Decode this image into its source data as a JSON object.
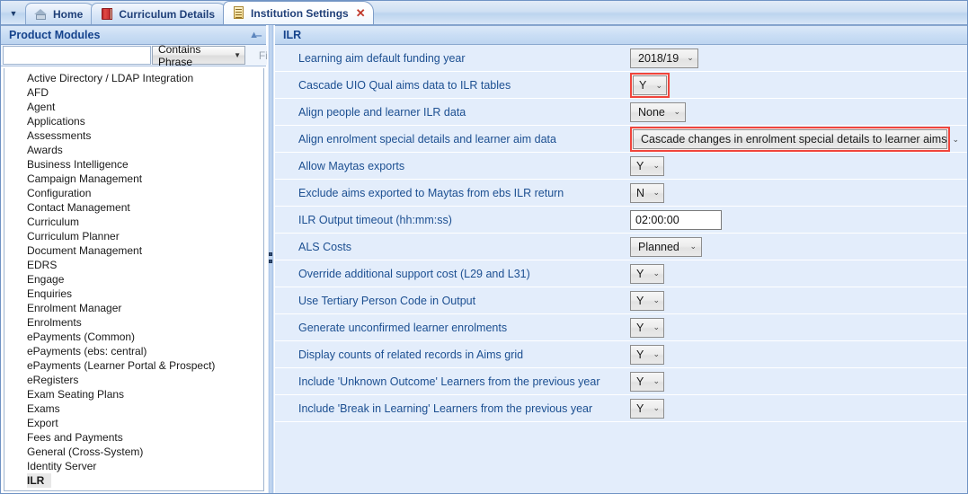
{
  "window": {
    "tab_dropdown_icon": "chevron-down-icon"
  },
  "tabs": [
    {
      "label": "Home",
      "icon": "home-icon",
      "active": false,
      "closable": false
    },
    {
      "label": "Curriculum Details",
      "icon": "book-icon",
      "active": false,
      "closable": false
    },
    {
      "label": "Institution Settings",
      "icon": "document-icon",
      "active": true,
      "closable": true,
      "close_label": "✕"
    }
  ],
  "left_panel": {
    "title": "Product Modules",
    "collapse_icon": "chevron-double-up-icon",
    "search": {
      "value": "",
      "placeholder": "",
      "match_mode": "Contains Phrase",
      "match_mode_arrow": "▼",
      "find_label": "Find"
    },
    "modules": [
      {
        "label": "Active Directory / LDAP Integration",
        "selected": false
      },
      {
        "label": "AFD",
        "selected": false
      },
      {
        "label": "Agent",
        "selected": false
      },
      {
        "label": "Applications",
        "selected": false
      },
      {
        "label": "Assessments",
        "selected": false
      },
      {
        "label": "Awards",
        "selected": false
      },
      {
        "label": "Business Intelligence",
        "selected": false
      },
      {
        "label": "Campaign Management",
        "selected": false
      },
      {
        "label": "Configuration",
        "selected": false
      },
      {
        "label": "Contact Management",
        "selected": false
      },
      {
        "label": "Curriculum",
        "selected": false
      },
      {
        "label": "Curriculum Planner",
        "selected": false
      },
      {
        "label": "Document Management",
        "selected": false
      },
      {
        "label": "EDRS",
        "selected": false
      },
      {
        "label": "Engage",
        "selected": false
      },
      {
        "label": "Enquiries",
        "selected": false
      },
      {
        "label": "Enrolment Manager",
        "selected": false
      },
      {
        "label": "Enrolments",
        "selected": false
      },
      {
        "label": "ePayments (Common)",
        "selected": false
      },
      {
        "label": "ePayments (ebs: central)",
        "selected": false
      },
      {
        "label": "ePayments (Learner Portal & Prospect)",
        "selected": false
      },
      {
        "label": "eRegisters",
        "selected": false
      },
      {
        "label": "Exam Seating Plans",
        "selected": false
      },
      {
        "label": "Exams",
        "selected": false
      },
      {
        "label": "Export",
        "selected": false
      },
      {
        "label": "Fees and Payments",
        "selected": false
      },
      {
        "label": "General (Cross-System)",
        "selected": false
      },
      {
        "label": "Identity Server",
        "selected": false
      },
      {
        "label": "ILR",
        "selected": true
      }
    ]
  },
  "right_panel": {
    "section_title": "ILR",
    "settings": [
      {
        "label": "Learning aim default funding year",
        "control": "combo",
        "value": "2018/19",
        "width": "w-year",
        "highlight": false
      },
      {
        "label": "Cascade UIO Qual aims data to ILR tables",
        "control": "combo",
        "value": "Y",
        "width": "w-yn",
        "highlight": true
      },
      {
        "label": "Align people and learner ILR data",
        "control": "combo",
        "value": "None",
        "width": "w-none",
        "highlight": false
      },
      {
        "label": "Align enrolment special details and learner aim data",
        "control": "combo",
        "value": "Cascade changes in enrolment special details to learner aims",
        "width": "w-wide",
        "highlight": true
      },
      {
        "label": "Allow Maytas exports",
        "control": "combo",
        "value": "Y",
        "width": "w-yn",
        "highlight": false
      },
      {
        "label": "Exclude aims exported to Maytas from ebs ILR return",
        "control": "combo",
        "value": "N",
        "width": "w-yn",
        "highlight": false
      },
      {
        "label": "ILR Output timeout (hh:mm:ss)",
        "control": "text",
        "value": "02:00:00",
        "width": "",
        "highlight": false
      },
      {
        "label": "ALS Costs",
        "control": "combo",
        "value": "Planned",
        "width": "w-als",
        "highlight": false
      },
      {
        "label": "Override additional support cost (L29 and L31)",
        "control": "combo",
        "value": "Y",
        "width": "w-yn",
        "highlight": false
      },
      {
        "label": "Use Tertiary Person Code in Output",
        "control": "combo",
        "value": "Y",
        "width": "w-yn",
        "highlight": false
      },
      {
        "label": "Generate unconfirmed learner enrolments",
        "control": "combo",
        "value": "Y",
        "width": "w-yn",
        "highlight": false
      },
      {
        "label": "Display counts of related records in Aims grid",
        "control": "combo",
        "value": "Y",
        "width": "w-yn",
        "highlight": false
      },
      {
        "label": "Include 'Unknown Outcome' Learners from the previous year",
        "control": "combo",
        "value": "Y",
        "width": "w-yn",
        "highlight": false
      },
      {
        "label": "Include 'Break in Learning' Learners from the previous year",
        "control": "combo",
        "value": "Y",
        "width": "w-yn",
        "highlight": false
      }
    ],
    "combo_arrow": "⌄"
  },
  "colors": {
    "accent_blue": "#15438c",
    "label_blue": "#1c4f91",
    "row_bg": "#e3edfb",
    "highlight_red": "#f0453c"
  }
}
